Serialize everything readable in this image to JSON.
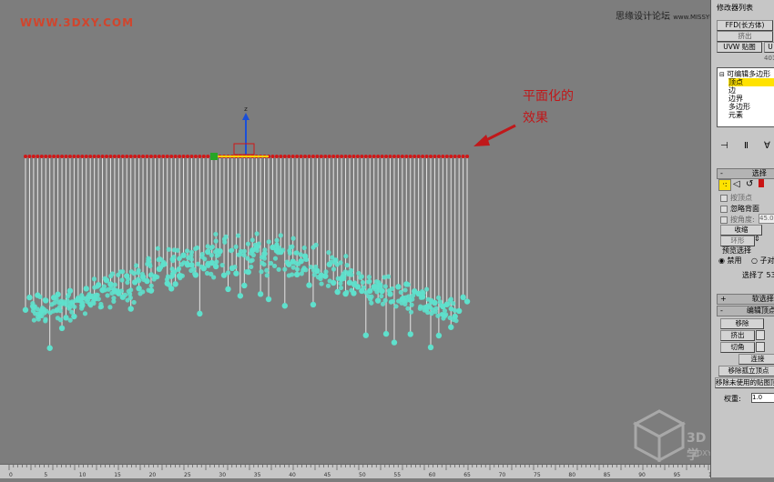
{
  "watermark_top_left": "WWW.3DXY.COM",
  "watermark_top_right": "思缘设计论坛",
  "watermark_site": "www.MISSYUAN.COM",
  "annotation": {
    "line1": "平面化的",
    "line2": "效果"
  },
  "gizmo_axis_label": "z",
  "panel": {
    "modifier_list": "修改器列表",
    "ffd_button": "FFD(长方体)",
    "extrude_button": "挤出",
    "uvw_button": "UVW 贴图",
    "u_button": "U",
    "hash_label": "4013",
    "stack": {
      "root": "可编辑多边形",
      "items": [
        "顶点",
        "边",
        "边界",
        "多边形",
        "元素"
      ],
      "selected": "顶点"
    },
    "select_section": "选择",
    "by_vertex": "按顶点",
    "ignore_backface": "忽略背面",
    "by_angle": "按角度:",
    "angle_value": "45.0",
    "shrink": "收缩",
    "ring": "环形",
    "preview_select": "预览选择",
    "disabled": "禁用",
    "sub_object": "子对象",
    "selected_count": "选择了 530",
    "soft_select": "软选择",
    "edit_vertices": "编辑顶点",
    "remove": "移除",
    "extrude": "挤出",
    "chamfer": "切角",
    "connect": "连接",
    "remove_isolated": "移除孤立顶点",
    "remove_unused": "移除未使用的贴图顶点",
    "weight_label": "权重:",
    "weight_value": "1.0"
  },
  "logo": {
    "text": "3D学院",
    "sub": "3DXY.COM"
  },
  "ruler_ticks": [
    "0",
    "5",
    "10",
    "15",
    "20",
    "25",
    "30",
    "35",
    "40",
    "45",
    "50",
    "55",
    "60",
    "65",
    "70",
    "75",
    "80",
    "85",
    "90",
    "95",
    "100"
  ],
  "colors": {
    "vertex_red": "#d01818",
    "vertex_cyan": "#5fe0cc",
    "line_white": "#e6e6e6",
    "selected_yellow": "#ffe200"
  }
}
